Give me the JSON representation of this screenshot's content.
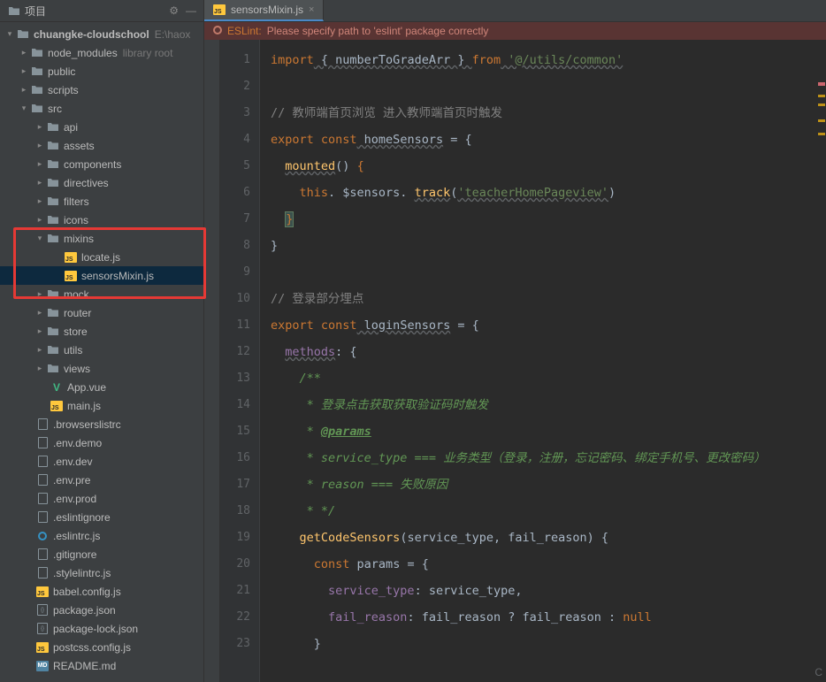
{
  "sidebar": {
    "title": "项目",
    "root": {
      "name": "chuangke-cloudschool",
      "path": "E:\\haox"
    },
    "nm": {
      "name": "node_modules",
      "note": "library root"
    },
    "folders": {
      "public": "public",
      "scripts": "scripts",
      "src": "src",
      "api": "api",
      "assets": "assets",
      "components": "components",
      "directives": "directives",
      "filters": "filters",
      "icons": "icons",
      "mixins": "mixins",
      "mock": "mock",
      "router": "router",
      "store": "store",
      "utils": "utils",
      "views": "views"
    },
    "files": {
      "locate": "locate.js",
      "sensorsMixin": "sensorsMixin.js",
      "appvue": "App.vue",
      "mainjs": "main.js",
      "browserslistrc": ".browserslistrc",
      "envdemo": ".env.demo",
      "envdev": ".env.dev",
      "envpre": ".env.pre",
      "envprod": ".env.prod",
      "eslintignore": ".eslintignore",
      "eslintrcjs": ".eslintrc.js",
      "gitignore": ".gitignore",
      "stylelintrc": ".stylelintrc.js",
      "babelconfig": "babel.config.js",
      "packagejson": "package.json",
      "packagelock": "package-lock.json",
      "postcss": "postcss.config.js",
      "readme": "README.md"
    }
  },
  "tab": {
    "name": "sensorsMixin.js"
  },
  "eslint": {
    "prefix": "ESLint:",
    "msg": "Please specify path to 'eslint' package correctly"
  },
  "lines": [
    "1",
    "2",
    "3",
    "4",
    "5",
    "6",
    "7",
    "8",
    "9",
    "10",
    "11",
    "12",
    "13",
    "14",
    "15",
    "16",
    "17",
    "18",
    "19",
    "20",
    "21",
    "22",
    "23"
  ],
  "code": {
    "l1_import": "import",
    "l1_braces": " { numberToGradeArr } ",
    "l1_from": "from",
    "l1_str": " '@/utils/common'",
    "l3": "// 教师端首页浏览 进入教师端首页时触发",
    "l4_export": "export const",
    "l4_name": " homeSensors",
    "l4_eq": " = {",
    "l5_mounted": "mounted",
    "l5_paren": "()",
    "l5_brace": " {",
    "l6_this": "this",
    "l6_dot": ". $sensors. ",
    "l6_track": "track",
    "l6_arg": "('teacherHomePageview')",
    "l6_arg_pre": "(",
    "l6_arg_str": "'teacherHomePageview'",
    "l6_arg_post": ")",
    "l7": "}",
    "l8": "}",
    "l10": "// 登录部分埋点",
    "l11_export": "export const",
    "l11_name": " loginSensors",
    "l11_eq": " = {",
    "l12_methods": "methods",
    "l12_brace": ": {",
    "l13": "/**",
    "l14": " * 登录点击获取获取验证码时触发",
    "l15_star": " * ",
    "l15_tag": "@params",
    "l16": " * service_type === 业务类型（登录，注册，忘记密码、绑定手机号、更改密码）",
    "l17": " * reason === 失败原因",
    "l18": " * */",
    "l19_fn": "getCodeSensors",
    "l19_args": "(service_type, fail_reason)",
    "l19_brace": " {",
    "l20_const": "const",
    "l20_rest": " params = {",
    "l21_key": "service_type",
    "l21_sep": ": service_type,",
    "l22_key": "fail_reason",
    "l22_mid": ": fail_reason ? fail_reason : ",
    "l22_null": "null",
    "l23": "}"
  },
  "bottomRight": "C"
}
